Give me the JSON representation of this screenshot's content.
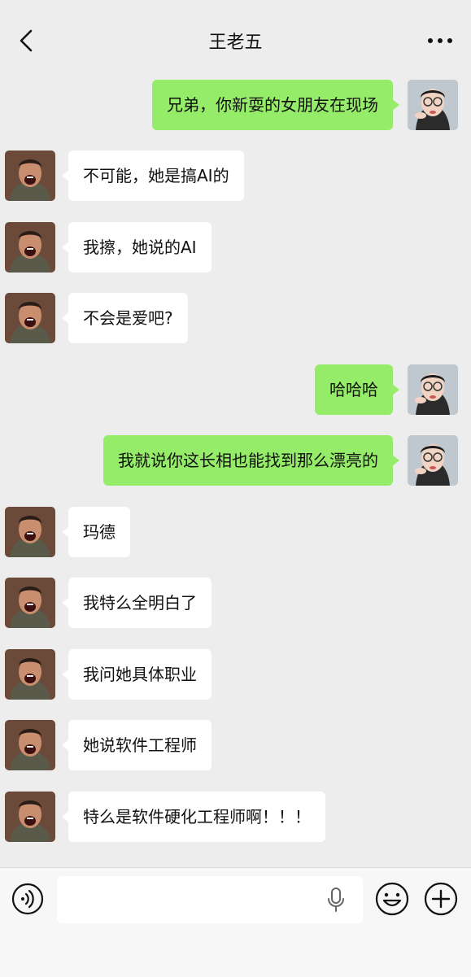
{
  "header": {
    "title": "王老五"
  },
  "messages": [
    {
      "side": "out",
      "text": "兄弟，你新耍的女朋友在现场"
    },
    {
      "side": "in",
      "text": "不可能，她是搞AI的"
    },
    {
      "side": "in",
      "text": "我擦，她说的AI"
    },
    {
      "side": "in",
      "text": "不会是爱吧?"
    },
    {
      "side": "out",
      "text": "哈哈哈"
    },
    {
      "side": "out",
      "text": "我就说你这长相也能找到那么漂亮的"
    },
    {
      "side": "in",
      "text": "玛德"
    },
    {
      "side": "in",
      "text": "我特么全明白了"
    },
    {
      "side": "in",
      "text": "我问她具体职业"
    },
    {
      "side": "in",
      "text": "她说软件工程师"
    },
    {
      "side": "in",
      "text": "特么是软件硬化工程师啊！！！"
    }
  ],
  "input_bar": {
    "text_value": "",
    "placeholder": ""
  },
  "colors": {
    "background": "#ededed",
    "outgoing_bubble": "#95ec69",
    "incoming_bubble": "#ffffff"
  },
  "icons": {
    "back": "chevron-left-icon",
    "more": "more-dots-icon",
    "voice": "voice-icon",
    "mic": "microphone-icon",
    "emoji": "emoji-icon",
    "plus": "plus-icon"
  }
}
